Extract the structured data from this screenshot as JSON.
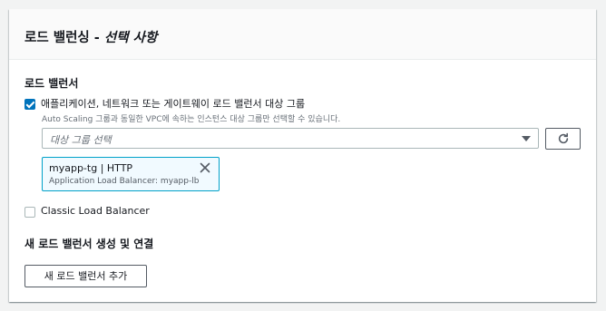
{
  "panel": {
    "title_main": "로드 밸런싱 - ",
    "title_optional": "선택 사항"
  },
  "load_balancer": {
    "section_label": "로드 밸런서",
    "target_group_option": {
      "label": "애플리케이션, 네트워크 또는 게이트웨이 로드 밸런서 대상 그룹",
      "description": "Auto Scaling 그룹과 동일한 VPC에 속하는 인스턴스 대상 그룹만 선택할 수 있습니다.",
      "checked": true
    },
    "select": {
      "placeholder": "대상 그룹 선택"
    },
    "selected_token": {
      "title": "myapp-tg | HTTP",
      "subtitle": "Application Load Balancer: myapp-lb"
    },
    "classic_option": {
      "label": "Classic Load Balancer",
      "checked": false
    }
  },
  "new_lb": {
    "section_label": "새 로드 밸런서 생성 및 연결",
    "add_button": "새 로드 밸런서 추가"
  },
  "colors": {
    "accent": "#0073bb",
    "token_border": "#00a1c9",
    "token_bg": "#f1faff"
  },
  "icons": {
    "refresh": "refresh-icon",
    "close": "close-icon",
    "caret": "caret-down-icon"
  }
}
